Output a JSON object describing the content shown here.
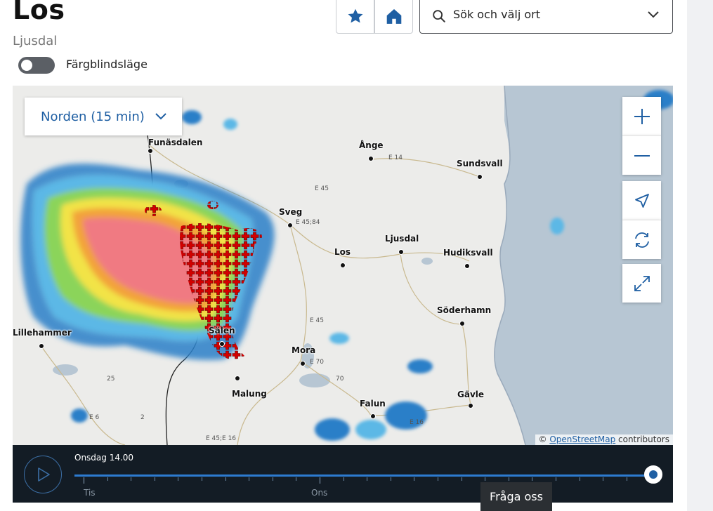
{
  "header": {
    "title": "Los",
    "subtitle": "Ljusdal"
  },
  "toggle": {
    "label": "Färgblindsläge",
    "on": false
  },
  "buttons": {
    "favorite_icon": "star-icon",
    "home_icon": "home-icon"
  },
  "search": {
    "placeholder": "Sök och välj ort",
    "icon": "search-icon"
  },
  "map": {
    "layer_selector": "Norden (15 min)",
    "cities": [
      "Funäsdalen",
      "Ånge",
      "Sundsvall",
      "Sveg",
      "Los",
      "Ljusdal",
      "Hudiksvall",
      "Söderhamn",
      "Lillehammer",
      "Sälen",
      "Mora",
      "Malung",
      "Falun",
      "Gävle"
    ],
    "roads": [
      "E 14",
      "E 45",
      "E 45;84",
      "E 45",
      "E 70",
      "70",
      "25",
      "E 6",
      "2",
      "E 45;E 16",
      "E 16"
    ],
    "controls": [
      "zoom-in",
      "zoom-out",
      "locate",
      "refresh",
      "fullscreen"
    ],
    "attribution": {
      "prefix": "©",
      "link": "OpenStreetMap",
      "suffix": "contributors"
    }
  },
  "timeline": {
    "current": "Onsdag 14.00",
    "days": [
      "Tis",
      "Ons"
    ],
    "position": 1.0
  },
  "help_button": "Fråga oss",
  "colors": {
    "accent": "#1f5fa3",
    "timebar": "#131c25",
    "lightning": "#d0021b"
  }
}
